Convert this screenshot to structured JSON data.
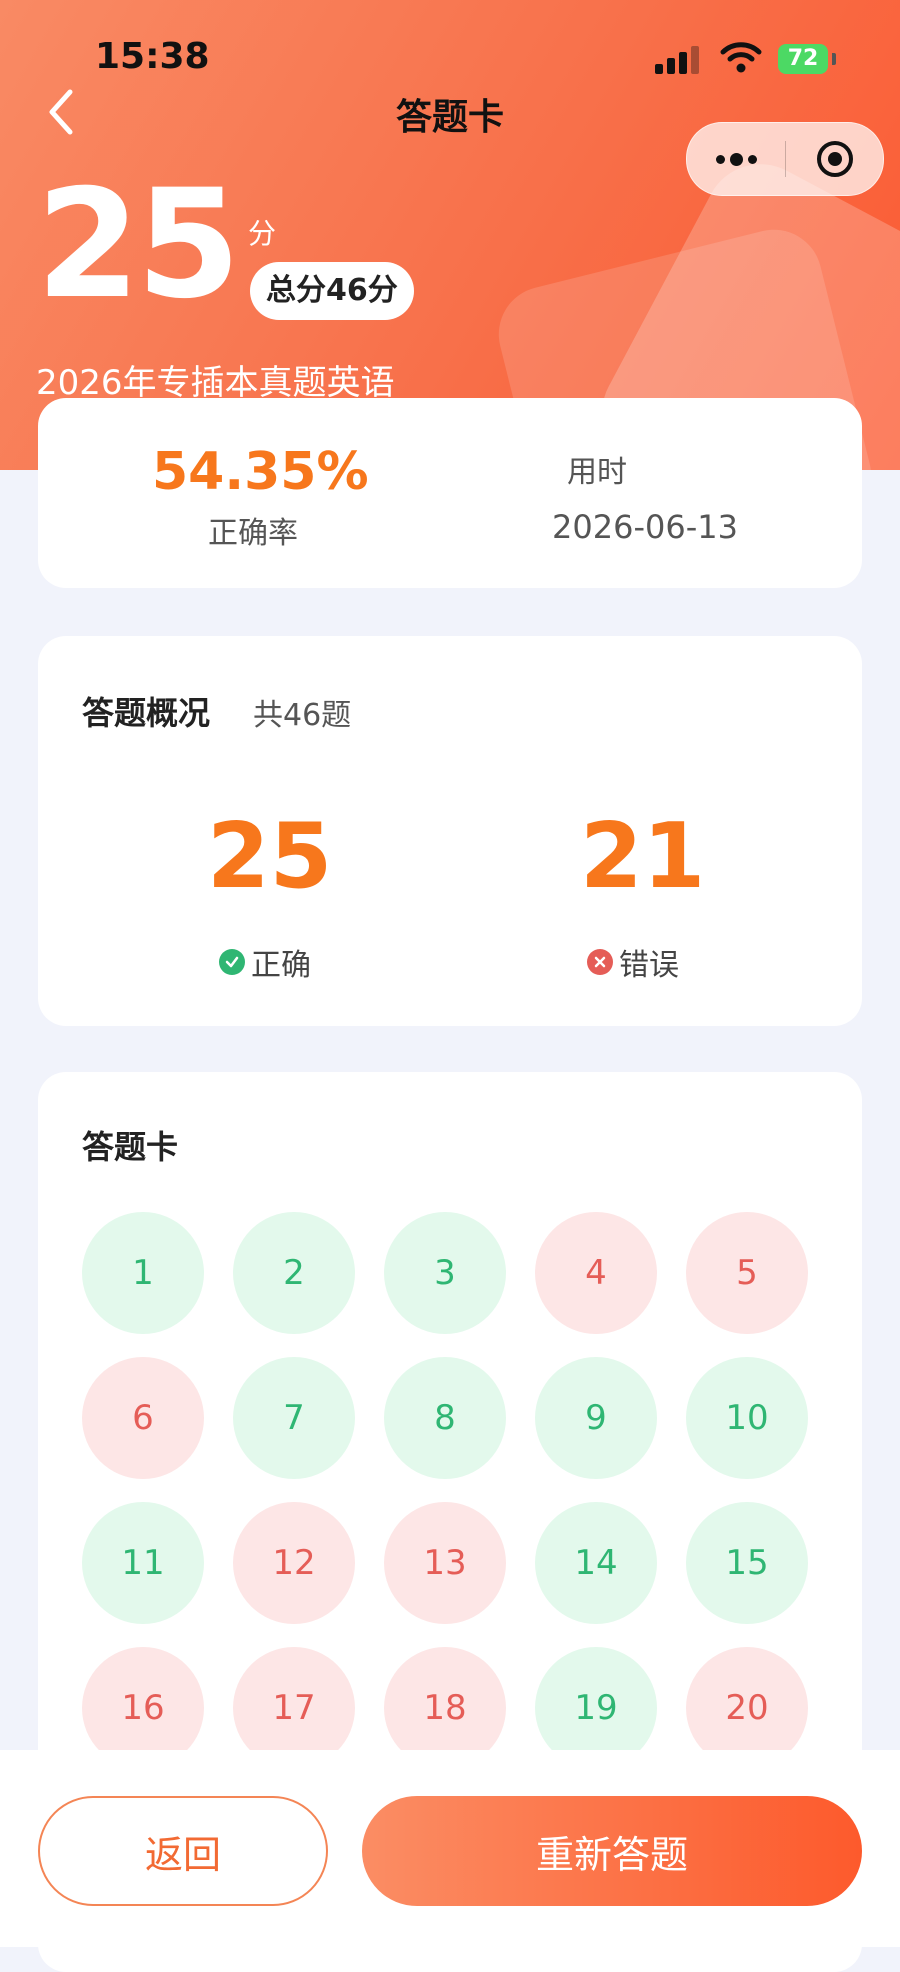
{
  "status_bar": {
    "time": "15:38",
    "battery": "72"
  },
  "nav": {
    "title": "答题卡"
  },
  "score": {
    "value": "25",
    "unit": "分",
    "total": "总分46分",
    "exam_name": "2026年专插本真题英语"
  },
  "stats": {
    "accuracy_value": "54.35%",
    "accuracy_label": "正确率",
    "time_label": "用时",
    "time_value": "2026-06-13"
  },
  "overview": {
    "title": "答题概况",
    "total": "共46题",
    "correct_count": "25",
    "correct_label": "正确",
    "wrong_count": "21",
    "wrong_label": "错误"
  },
  "answer_card": {
    "title": "答题卡",
    "items": [
      {
        "num": "1",
        "status": "correct"
      },
      {
        "num": "2",
        "status": "correct"
      },
      {
        "num": "3",
        "status": "correct"
      },
      {
        "num": "4",
        "status": "wrong"
      },
      {
        "num": "5",
        "status": "wrong"
      },
      {
        "num": "6",
        "status": "wrong"
      },
      {
        "num": "7",
        "status": "correct"
      },
      {
        "num": "8",
        "status": "correct"
      },
      {
        "num": "9",
        "status": "correct"
      },
      {
        "num": "10",
        "status": "correct"
      },
      {
        "num": "11",
        "status": "correct"
      },
      {
        "num": "12",
        "status": "wrong"
      },
      {
        "num": "13",
        "status": "wrong"
      },
      {
        "num": "14",
        "status": "correct"
      },
      {
        "num": "15",
        "status": "correct"
      },
      {
        "num": "16",
        "status": "wrong"
      },
      {
        "num": "17",
        "status": "wrong"
      },
      {
        "num": "18",
        "status": "wrong"
      },
      {
        "num": "19",
        "status": "correct"
      },
      {
        "num": "20",
        "status": "wrong"
      }
    ]
  },
  "buttons": {
    "back_label": "返回",
    "retry_label": "重新答题"
  },
  "colors": {
    "accent": "#f7771c",
    "correct": "#2fb673",
    "wrong": "#e55d57"
  }
}
